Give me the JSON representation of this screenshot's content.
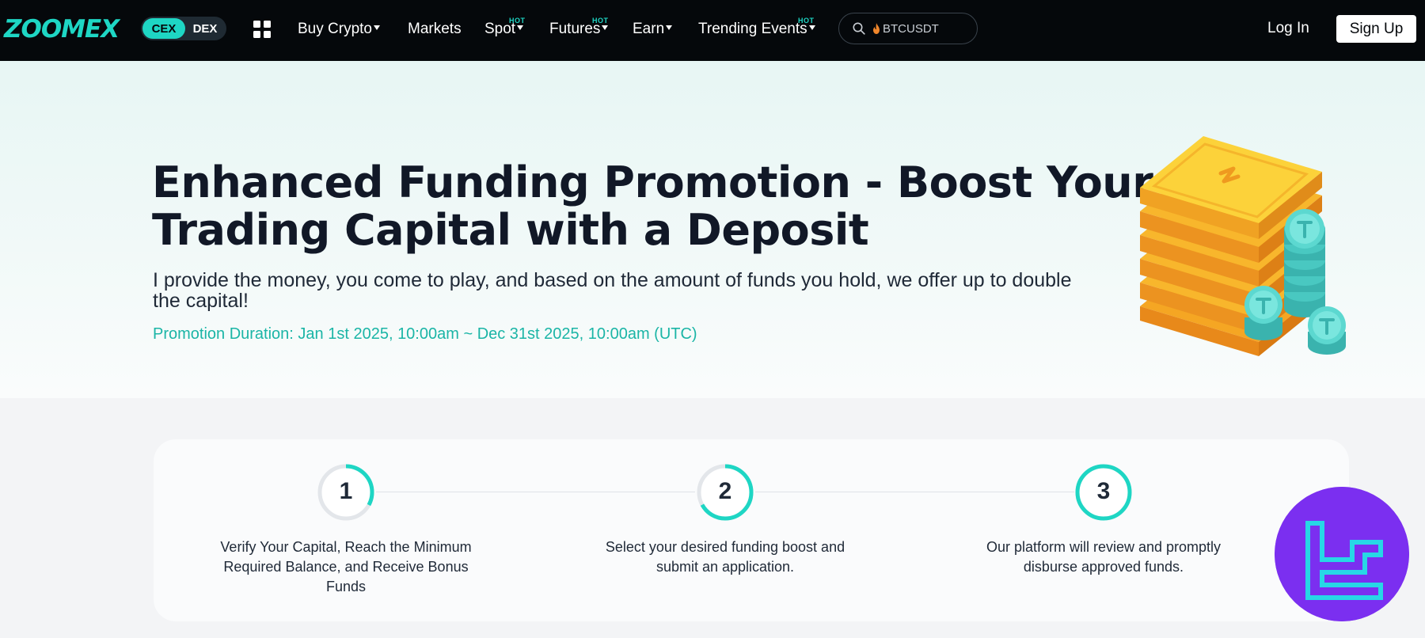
{
  "nav": {
    "logo": "ZOOMEX",
    "cex": "CEX",
    "dex": "DEX",
    "items": [
      {
        "label": "Buy Crypto",
        "hot": ""
      },
      {
        "label": "Markets",
        "hot": ""
      },
      {
        "label": "Spot",
        "hot": "HOT"
      },
      {
        "label": "Futures",
        "hot": "HOT"
      },
      {
        "label": "Earn",
        "hot": ""
      },
      {
        "label": "Trending Events",
        "hot": "HOT"
      }
    ],
    "search_placeholder": "BTCUSDT",
    "login": "Log In",
    "signup": "Sign Up"
  },
  "hero": {
    "title": "Enhanced Funding Promotion - Boost Your Trading Capital with a Deposit",
    "subtitle": "I provide the money, you come to play, and based on the amount of funds you hold, we offer up to double the capital!",
    "duration": "Promotion Duration: Jan 1st 2025, 10:00am ~ Dec 31st 2025, 10:00am (UTC)"
  },
  "steps": [
    {
      "number": "1",
      "text": "Verify Your Capital, Reach the Minimum Required Balance, and Receive Bonus Funds",
      "progress": 0.33
    },
    {
      "number": "2",
      "text": "Select your desired funding boost and submit an application.",
      "progress": 0.67
    },
    {
      "number": "3",
      "text": "Our platform will review and promptly disburse approved funds.",
      "progress": 1.0
    }
  ],
  "colors": {
    "accent": "#1ed6c4",
    "nav_bg": "#05080b",
    "badge": "#7b2ff0"
  },
  "icons": {
    "grid": "apps-grid-icon",
    "search": "search-icon",
    "flame": "flame-icon",
    "badge": "tc-logo-icon"
  }
}
